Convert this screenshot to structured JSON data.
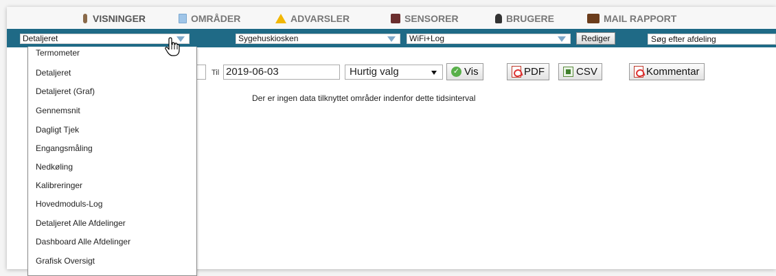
{
  "nav": {
    "items": [
      {
        "label": "VISNINGER",
        "icon": "thermometer-icon"
      },
      {
        "label": "OMRÅDER",
        "icon": "document-icon"
      },
      {
        "label": "ADVARSLER",
        "icon": "warning-icon"
      },
      {
        "label": "SENSORER",
        "icon": "sensor-icon"
      },
      {
        "label": "BRUGERE",
        "icon": "user-icon"
      },
      {
        "label": "MAIL RAPPORT",
        "icon": "mail-icon"
      }
    ]
  },
  "filters": {
    "view_select": "Detaljeret",
    "location_select": "Sygehuskiosken",
    "sensor_select": "WiFi+Log",
    "edit_button": "Rediger",
    "search_placeholder": "Søg efter afdeling"
  },
  "date": {
    "til_label": "Til",
    "til_value": "2019-06-03",
    "quick_select": "Hurtig valg",
    "vis_button": "Vis",
    "pdf_button": "PDF",
    "csv_button": "CSV",
    "comment_button": "Kommentar"
  },
  "message": "Der er ingen data tilknyttet områder indenfor dette tidsinterval",
  "dropdown": {
    "options": [
      "Termometer",
      "Detaljeret",
      "Detaljeret (Graf)",
      "Gennemsnit",
      "Dagligt Tjek",
      "Engangsmåling",
      "Nedkøling",
      "Kalibreringer",
      "Hovedmoduls-Log",
      "Detaljeret Alle Afdelinger",
      "Dashboard Alle Afdelinger",
      "Grafisk Oversigt"
    ]
  },
  "colors": {
    "filter_bar": "#1f6a86",
    "nav_text": "#777777"
  }
}
